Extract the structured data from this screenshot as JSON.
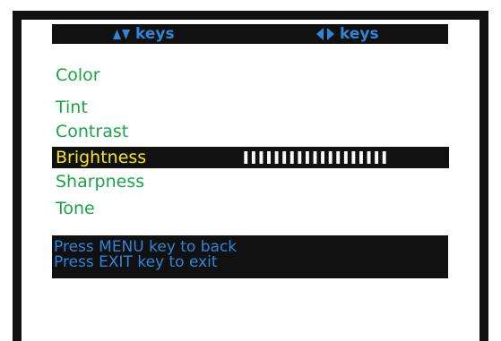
{
  "header": {
    "up_down_label": "keys",
    "left_right_label": "keys",
    "icon_color": "#2f86d8"
  },
  "menu": {
    "items": [
      {
        "label": "Color"
      },
      {
        "label": "Tint"
      },
      {
        "label": "Contrast"
      },
      {
        "label": "Brightness"
      },
      {
        "label": "Sharpness"
      },
      {
        "label": "Tone"
      }
    ],
    "selected_index": 3,
    "brightness_level": 1.0,
    "brightness_segments": 19,
    "item_color": "#18a548",
    "selected_color": "#f5e51c"
  },
  "help": {
    "line_1": "Press MENU key to back",
    "line_2": "Press EXIT key to exit",
    "color": "#2f86d8"
  },
  "icons": {
    "up_down": "up-down-arrows-icon",
    "left_right": "left-right-arrows-icon"
  }
}
